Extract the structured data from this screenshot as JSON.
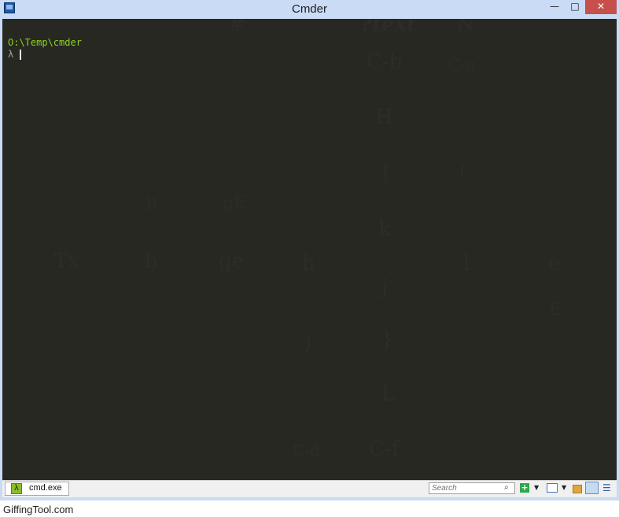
{
  "window": {
    "title": "Cmder",
    "controls": {
      "minimize": "—",
      "maximize": "□",
      "close": "✕"
    }
  },
  "console": {
    "path": "O:\\Temp\\cmder",
    "prompt": "λ"
  },
  "background_cheatsheet": {
    "glyphs": [
      "#",
      "?text",
      "N",
      "C-b",
      "C-u",
      "H",
      "{",
      "(",
      "B",
      "gE",
      "k",
      "Tx",
      "b",
      "ge",
      "h",
      "l",
      "e",
      "j",
      "E",
      ")",
      "}",
      "L",
      "C-d",
      "C-f"
    ]
  },
  "statusbar": {
    "tab_icon": "λ",
    "tab_label": "cmd.exe",
    "search_placeholder": "Search",
    "search_icon": "⌕",
    "add_icon": "+",
    "dropdown_icon": "▼",
    "menu_icon": "☰"
  },
  "watermark": "GiffingTool.com"
}
